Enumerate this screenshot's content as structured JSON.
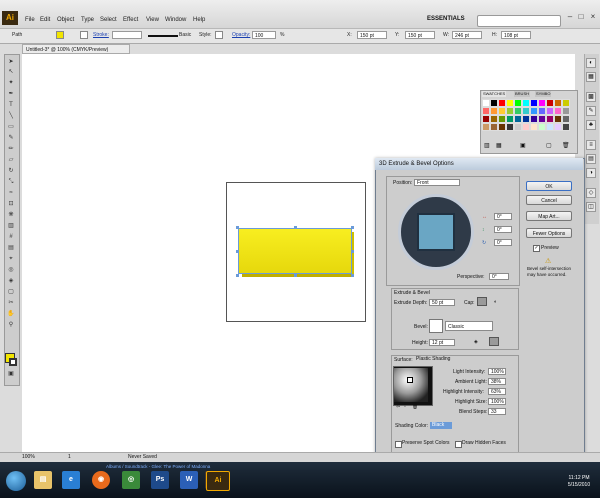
{
  "menu": {
    "items": [
      "File",
      "Edit",
      "Object",
      "Type",
      "Select",
      "Effect",
      "View",
      "Window",
      "Help"
    ],
    "workspace": "ESSENTIALS"
  },
  "control_bar": {
    "selection": "Path",
    "stroke_link": "Stroke:",
    "brush": "Basic",
    "style_label": "Style:",
    "opacity_link": "Opacity:",
    "opacity_value": "100",
    "pct": "%",
    "x_label": "X:",
    "x_value": "150 pt",
    "y_label": "Y:",
    "y_value": "150 pt",
    "w_label": "W:",
    "w_value": "246 pt",
    "h_label": "H:",
    "h_value": "108 pt"
  },
  "document": {
    "tab_title": "Untitled-3* @ 100% (CMYK/Preview)"
  },
  "swatches": {
    "tabs": [
      "SWATCHES",
      "BRUSH",
      "SYMBO"
    ],
    "colors": [
      "#ffffff",
      "#000000",
      "#ff0000",
      "#ffff00",
      "#00ff00",
      "#00ffff",
      "#0000ff",
      "#ff00ff",
      "#cc0000",
      "#cc6600",
      "#cccc00",
      "#ff6666",
      "#ff9933",
      "#ffcc33",
      "#99cc33",
      "#33cc66",
      "#33cccc",
      "#3399ff",
      "#6666ff",
      "#cc66ff",
      "#ff66cc",
      "#999999",
      "#990000",
      "#996600",
      "#669900",
      "#009966",
      "#006699",
      "#003399",
      "#330099",
      "#660099",
      "#990066",
      "#663300",
      "#666666",
      "#cc9966",
      "#996633",
      "#663300",
      "#333333",
      "#cccccc",
      "#ffcccc",
      "#ffe5cc",
      "#ccffcc",
      "#cce5ff",
      "#e5ccff",
      "#444444"
    ]
  },
  "dialog": {
    "title": "3D Extrude & Bevel Options",
    "position_label": "Position:",
    "position_value": "Front",
    "rot_x": "0°",
    "rot_y": "0°",
    "rot_z": "0°",
    "perspective_label": "Perspective:",
    "perspective_value": "0°",
    "extrude_group": "Extrude & Bevel",
    "extrude_depth_label": "Extrude Depth:",
    "extrude_depth_value": "50 pt",
    "cap_label": "Cap:",
    "bevel_label": "Bevel:",
    "bevel_value": "Classic",
    "height_label": "Height:",
    "height_value": "12 pt",
    "surface_label": "Surface:",
    "surface_value": "Plastic Shading",
    "light_intensity_label": "Light Intensity:",
    "light_intensity_value": "100%",
    "ambient_label": "Ambient Light:",
    "ambient_value": "38%",
    "highlight_intensity_label": "Highlight Intensity:",
    "highlight_intensity_value": "63%",
    "highlight_size_label": "Highlight Size:",
    "highlight_size_value": "100%",
    "blend_steps_label": "Blend Steps:",
    "blend_steps_value": "33",
    "shading_color_label": "Shading Color:",
    "shading_color_value": "Black",
    "preserve_label": "Preserve Spot Colors",
    "draw_hidden_label": "Draw Hidden Faces",
    "ok": "OK",
    "cancel": "Cancel",
    "map_art": "Map Art...",
    "fewer_options": "Fewer Options",
    "preview": "Preview",
    "warning": "Bevel self-intersection may have occurred."
  },
  "status": {
    "zoom": "100%",
    "page": "1",
    "saved": "Never Saved"
  },
  "taskbar": {
    "media": "Albums / Soundtrack - Glee: The Power of Madonna",
    "time": "11:12 PM",
    "date": "5/15/2010"
  }
}
